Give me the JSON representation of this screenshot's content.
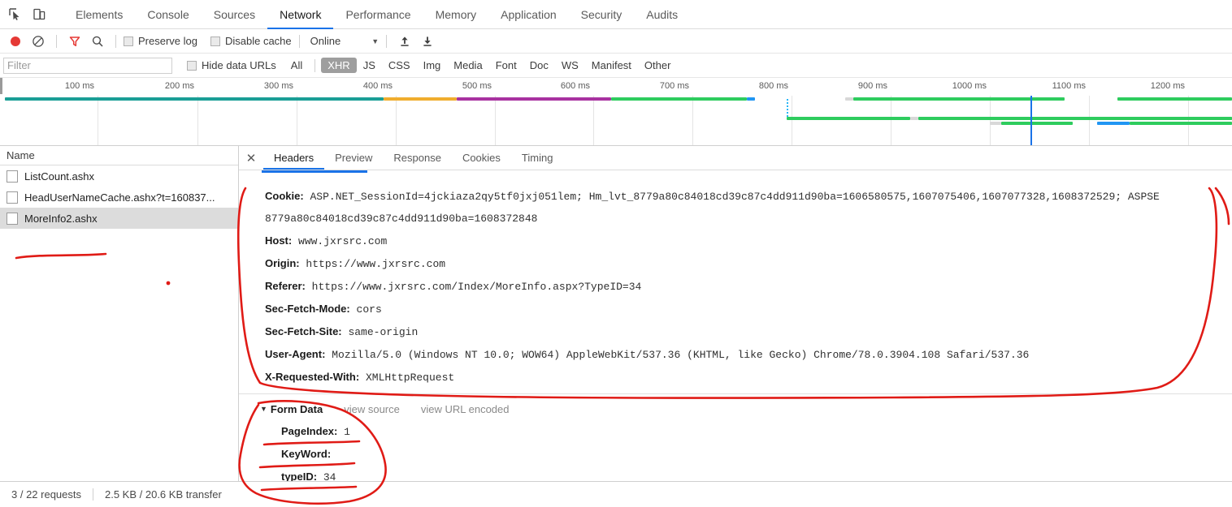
{
  "devtools": {
    "panel_tabs": [
      {
        "label": "Elements",
        "active": false
      },
      {
        "label": "Console",
        "active": false
      },
      {
        "label": "Sources",
        "active": false
      },
      {
        "label": "Network",
        "active": true
      },
      {
        "label": "Performance",
        "active": false
      },
      {
        "label": "Memory",
        "active": false
      },
      {
        "label": "Application",
        "active": false
      },
      {
        "label": "Security",
        "active": false
      },
      {
        "label": "Audits",
        "active": false
      }
    ],
    "inspect_icons": [
      "inspect-element-icon",
      "device-toolbar-icon"
    ],
    "toolbar": {
      "record_icon": "record-icon",
      "record_color": "#e53935",
      "clear_icon": "clear-icon",
      "filter_icon": "funnel-icon",
      "filter_icon_color": "#e53935",
      "search_icon": "search-icon",
      "preserve_log_label": "Preserve log",
      "disable_cache_label": "Disable cache",
      "throttle_value": "Online",
      "throttle_caret": "▼",
      "import_icon": "upload-arrow-icon",
      "export_icon": "download-arrow-icon"
    },
    "filterbar": {
      "filter_placeholder": "Filter",
      "filter_value": "",
      "hide_data_urls_label": "Hide data URLs",
      "type_chips": [
        {
          "label": "All",
          "on": false
        },
        {
          "label": "XHR",
          "on": true
        },
        {
          "label": "JS",
          "on": false
        },
        {
          "label": "CSS",
          "on": false
        },
        {
          "label": "Img",
          "on": false
        },
        {
          "label": "Media",
          "on": false
        },
        {
          "label": "Font",
          "on": false
        },
        {
          "label": "Doc",
          "on": false
        },
        {
          "label": "WS",
          "on": false
        },
        {
          "label": "Manifest",
          "on": false
        },
        {
          "label": "Other",
          "on": false
        }
      ]
    },
    "overview": {
      "ticks": [
        "100 ms",
        "200 ms",
        "300 ms",
        "400 ms",
        "500 ms",
        "600 ms",
        "700 ms",
        "800 ms",
        "900 ms",
        "1000 ms",
        "1100 ms",
        "1200 ms"
      ],
      "colors": {
        "teal": "#1a9e96",
        "orange": "#f0ad2e",
        "purple": "#a832a0",
        "green": "#2ecc5e",
        "blue": "#2196f3",
        "grey": "#d8d8d8",
        "playhead": "#1a73e8"
      }
    },
    "requests": {
      "column_header": "Name",
      "rows": [
        {
          "name": "ListCount.ashx",
          "selected": false
        },
        {
          "name": "HeadUserNameCache.ashx?t=160837...",
          "selected": false
        },
        {
          "name": "MoreInfo2.ashx",
          "selected": true
        }
      ]
    },
    "detail": {
      "close_icon": "close-icon",
      "tabs": [
        {
          "label": "Headers",
          "active": true
        },
        {
          "label": "Preview",
          "active": false
        },
        {
          "label": "Response",
          "active": false
        },
        {
          "label": "Cookies",
          "active": false
        },
        {
          "label": "Timing",
          "active": false
        }
      ],
      "headers": [
        {
          "key": "Cookie:",
          "value": "ASP.NET_SessionId=4jckiaza2qy5tf0jxj051lem; Hm_lvt_8779a80c84018cd39c87c4dd911d90ba=1606580575,1607075406,1607077328,1608372529; ASPSE"
        },
        {
          "key": "",
          "value": "8779a80c84018cd39c87c4dd911d90ba=1608372848",
          "continuation": true
        },
        {
          "key": "Host:",
          "value": "www.jxrsrc.com"
        },
        {
          "key": "Origin:",
          "value": "https://www.jxrsrc.com"
        },
        {
          "key": "Referer:",
          "value": "https://www.jxrsrc.com/Index/MoreInfo.aspx?TypeID=34"
        },
        {
          "key": "Sec-Fetch-Mode:",
          "value": "cors"
        },
        {
          "key": "Sec-Fetch-Site:",
          "value": "same-origin"
        },
        {
          "key": "User-Agent:",
          "value": "Mozilla/5.0 (Windows NT 10.0; WOW64) AppleWebKit/537.36 (KHTML, like Gecko) Chrome/78.0.3904.108 Safari/537.36"
        },
        {
          "key": "X-Requested-With:",
          "value": "XMLHttpRequest"
        }
      ],
      "form_data": {
        "triangle": "▼",
        "title": "Form Data",
        "view_source_label": "view source",
        "view_url_encoded_label": "view URL encoded",
        "fields": [
          {
            "key": "PageIndex:",
            "value": "1"
          },
          {
            "key": "KeyWord:",
            "value": ""
          },
          {
            "key": "typeID:",
            "value": "34"
          }
        ]
      }
    },
    "statusbar": {
      "requests_text": "3 / 22 requests",
      "transfer_text": "2.5 KB / 20.6 KB transfer"
    },
    "annotations": {
      "ink_color": "#e01b16",
      "marks": [
        "underline-moreinfo2-row",
        "loop-around-request-headers",
        "loop-around-form-data",
        "underline-pageindex",
        "underline-keyword",
        "underline-typeid",
        "dot-mark"
      ]
    }
  }
}
